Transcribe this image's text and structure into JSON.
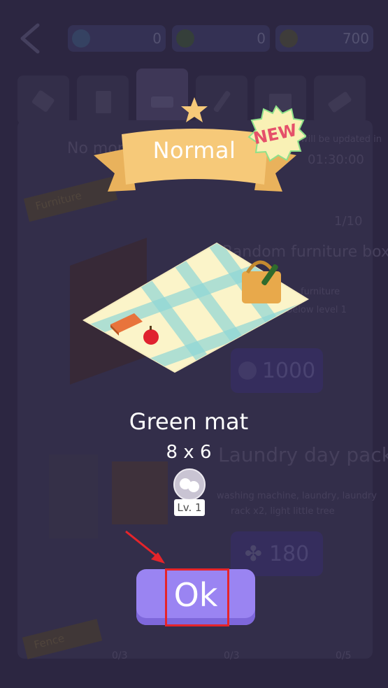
{
  "topbar": {
    "gems": "0",
    "clovers": "0",
    "coins": "700"
  },
  "background": {
    "no_more_text": "No more",
    "refresh_note_line1": "will be updated in",
    "refresh_note_line2": "01:30:00",
    "furniture_label": "Furniture",
    "counter": "1/10",
    "box_title": "Random furniture box",
    "box_desc_line1": "furniture",
    "box_desc_line2": "below level 1",
    "box_price": "1000",
    "pack_title": "Laundry day pack",
    "pack_desc_line1": "washing machine, laundry, laundry",
    "pack_desc_line2": "rack x2, light little tree",
    "pack_price": "180",
    "fence_label": "Fence",
    "bottom_counts": [
      "0/3",
      "0/3",
      "0/5"
    ]
  },
  "modal": {
    "rarity": "Normal",
    "badge": "NEW",
    "item_name": "Green mat",
    "item_size": "8 x 6",
    "level": "Lv. 1",
    "ok_label": "Ok"
  },
  "colors": {
    "ok_button": "#9a84f2",
    "banner": "#f6c979",
    "highlight": "#e6242a"
  }
}
